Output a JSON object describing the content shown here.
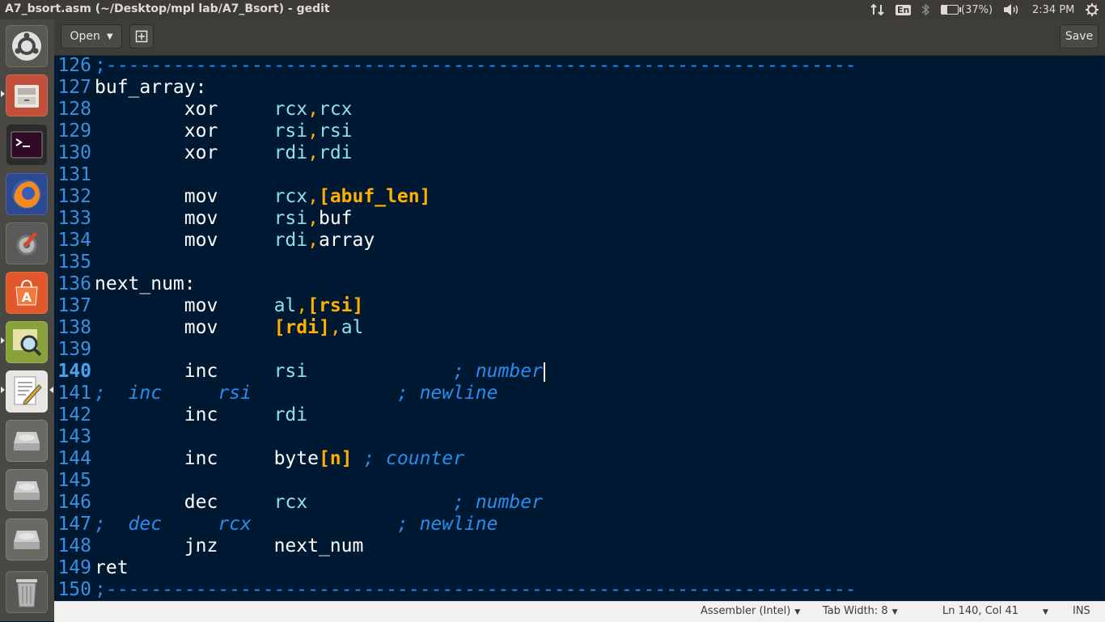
{
  "window": {
    "title": "A7_bsort.asm (~/Desktop/mpl lab/A7_Bsort) - gedit"
  },
  "tray": {
    "keyboard": "En",
    "battery_text": "(37%)",
    "battery_level": 0.37,
    "clock": "2:34 PM"
  },
  "toolbar": {
    "open_label": "Open",
    "save_label": "Save"
  },
  "editor": {
    "current_line": 140,
    "lines": [
      {
        "num": "126",
        "code": ";-------------------------------------------------------------------"
      },
      {
        "num": "127",
        "code": "buf_array:"
      },
      {
        "num": "128",
        "code": "        xor     rcx,rcx"
      },
      {
        "num": "129",
        "code": "        xor     rsi,rsi"
      },
      {
        "num": "130",
        "code": "        xor     rdi,rdi"
      },
      {
        "num": "131",
        "code": ""
      },
      {
        "num": "132",
        "code": "        mov     rcx,[abuf_len]"
      },
      {
        "num": "133",
        "code": "        mov     rsi,buf"
      },
      {
        "num": "134",
        "code": "        mov     rdi,array"
      },
      {
        "num": "135",
        "code": ""
      },
      {
        "num": "136",
        "code": "next_num:"
      },
      {
        "num": "137",
        "code": "        mov     al,[rsi]"
      },
      {
        "num": "138",
        "code": "        mov     [rdi],al"
      },
      {
        "num": "139",
        "code": ""
      },
      {
        "num": "140",
        "code": "        inc     rsi             ; number"
      },
      {
        "num": "141",
        "code": "     ;  inc     rsi             ; newline"
      },
      {
        "num": "142",
        "code": "        inc     rdi"
      },
      {
        "num": "143",
        "code": ""
      },
      {
        "num": "144",
        "code": "        inc     byte[n] ; counter"
      },
      {
        "num": "145",
        "code": ""
      },
      {
        "num": "146",
        "code": "        dec     rcx             ; number"
      },
      {
        "num": "147",
        "code": "     ;  dec     rcx             ; newline"
      },
      {
        "num": "148",
        "code": "        jnz     next_num"
      },
      {
        "num": "149",
        "code": "ret"
      },
      {
        "num": "150",
        "code": ";-------------------------------------------------------------------"
      }
    ]
  },
  "statusbar": {
    "language": "Assembler (Intel)",
    "tab_width": "Tab Width: 8",
    "position": "Ln 140, Col 41",
    "mode": "INS"
  },
  "colors": {
    "editor_bg": "#001933",
    "line_number": "#3c8fdc",
    "register": "#8ee1ea",
    "punctuation": "#ffb000",
    "comment": "#2a8cec"
  },
  "launcher_icons": [
    "ubuntu-dash-icon",
    "files-icon",
    "terminal-icon",
    "firefox-icon",
    "system-settings-icon",
    "software-center-icon",
    "image-viewer-icon",
    "text-editor-icon",
    "drive-icon",
    "drive-icon",
    "drive-icon",
    "trash-icon"
  ]
}
